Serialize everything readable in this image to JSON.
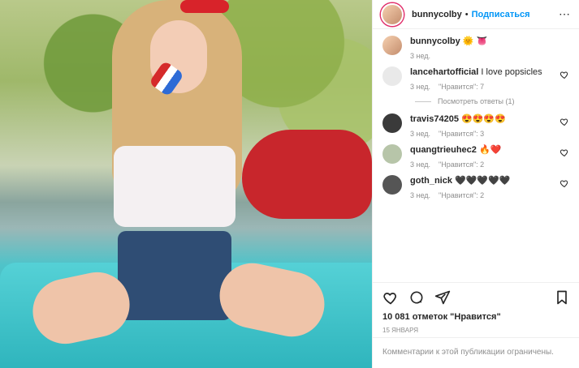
{
  "header": {
    "username": "bunnycolby",
    "separator": "•",
    "follow_label": "Подписаться",
    "more_label": "⋯"
  },
  "caption": {
    "username": "bunnycolby",
    "emoji": "🌞 👅",
    "time": "3 нед."
  },
  "comments": [
    {
      "username": "lancehartofficial",
      "text": "I love popsicles",
      "time": "3 нед.",
      "likes": "\"Нравится\": 7",
      "view_replies": "Посмотреть ответы (1)"
    },
    {
      "username": "travis74205",
      "text": "😍😍😍😍",
      "time": "3 нед.",
      "likes": "\"Нравится\": 3"
    },
    {
      "username": "quangtrieuhec2",
      "text": "🔥❤️",
      "time": "3 нед.",
      "likes": "\"Нравится\": 2"
    },
    {
      "username": "goth_nick",
      "text": "🖤🖤🖤🖤🖤",
      "time": "3 нед.",
      "likes": "\"Нравится\": 2"
    }
  ],
  "post": {
    "likes_text": "10 081 отметок \"Нравится\"",
    "date": "15 января",
    "comments_closed": "Комментарии к этой публикации ограничены."
  },
  "icons": {
    "like": "heart-icon",
    "comment": "comment-icon",
    "share": "paper-plane-icon",
    "save": "bookmark-icon"
  },
  "colors": {
    "accent": "#0095f6",
    "muted": "#8e8e8e",
    "border": "#efefef"
  }
}
